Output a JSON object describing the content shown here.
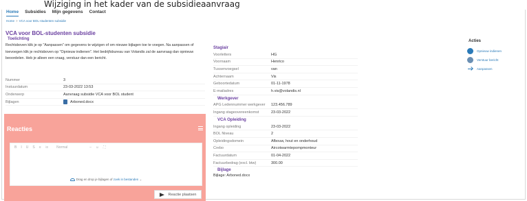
{
  "caption": "Wijziging in het kader van de subsidieaanvraag",
  "nav": [
    "Home",
    "Subsidies",
    "Mijn gegevens",
    "Contact"
  ],
  "breadcrumb": [
    "Home",
    "VCA voor BOL-studenten subsidie"
  ],
  "page": {
    "title": "VCA voor BOL-studenten subsidie",
    "toelichting_heading": "Toelichting",
    "toelichting": "Rechtsboven klik je op \"Aanpassen\" om gegevens te wijzigen of om nieuwe bijlagen toe te voegen. Na aanpassen of toevoegen klik je rechtsboven op \"Opnieuw indienen\". Het bedrijfsbureau van Volandis zal de aanvraag dan opnieuw beoordelen. Heb je alleen een vraag, verstuur dan een bericht."
  },
  "meta": [
    {
      "label": "Nummer",
      "value": "3"
    },
    {
      "label": "Instuurdatum",
      "value": "23-03-2022 13:53"
    },
    {
      "label": "Onderwerp",
      "value": "Aanvraag subsidie VCA voor BOL student"
    },
    {
      "label": "Bijlagen",
      "value": "Arboned.docx"
    }
  ],
  "reacties": {
    "heading": "Reacties",
    "toolbar": [
      "B",
      "I",
      "U",
      "S",
      "≡",
      "⁝≡",
      "Normal",
      "–",
      "☺",
      "⛶"
    ],
    "drop_text": "Drag en drop je bijlagen of",
    "drop_link": "zoek in bestanden",
    "post_button": "Reactie plaatsen"
  },
  "stagiair": {
    "heading": "Stagiair",
    "rows": [
      {
        "label": "Voorletters",
        "value": "HG"
      },
      {
        "label": "Voornaam",
        "value": "Henrico"
      },
      {
        "label": "Tussenvoegsel",
        "value": "van"
      },
      {
        "label": "Achternaam",
        "value": "Vis"
      },
      {
        "label": "Geboortedatum",
        "value": "01-11-1978"
      },
      {
        "label": "E-mailadres",
        "value": "h.vis@volandis.nl"
      }
    ]
  },
  "werkgever": {
    "heading": "Werkgever",
    "rows": [
      {
        "label": "APG Ledennummer werkgever",
        "value": "123.456.789"
      },
      {
        "label": "Ingang stageovereenkomst",
        "value": "23-03-2022"
      }
    ]
  },
  "vca": {
    "heading": "VCA Opleiding",
    "rows": [
      {
        "label": "Ingang opleiding",
        "value": "23-03-2022"
      },
      {
        "label": "BOL Niveau",
        "value": "2"
      },
      {
        "label": "Opleidingsdomein",
        "value": "Afbouw, hout en onderhoud"
      },
      {
        "label": "Crebo",
        "value": "Aircotwarmtepompmonteur"
      },
      {
        "label": "Factuurdatum",
        "value": "01-04-2022"
      },
      {
        "label": "Factuurbedrag (excl. btw)",
        "value": "300.00"
      }
    ]
  },
  "bijlage": {
    "heading": "Bijlage",
    "text": "Bijlage: Arboned.docx"
  },
  "acties": {
    "heading": "Acties",
    "items": [
      "Opnieuw indienen",
      "Verstuur bericht",
      "Aanpassen"
    ]
  }
}
